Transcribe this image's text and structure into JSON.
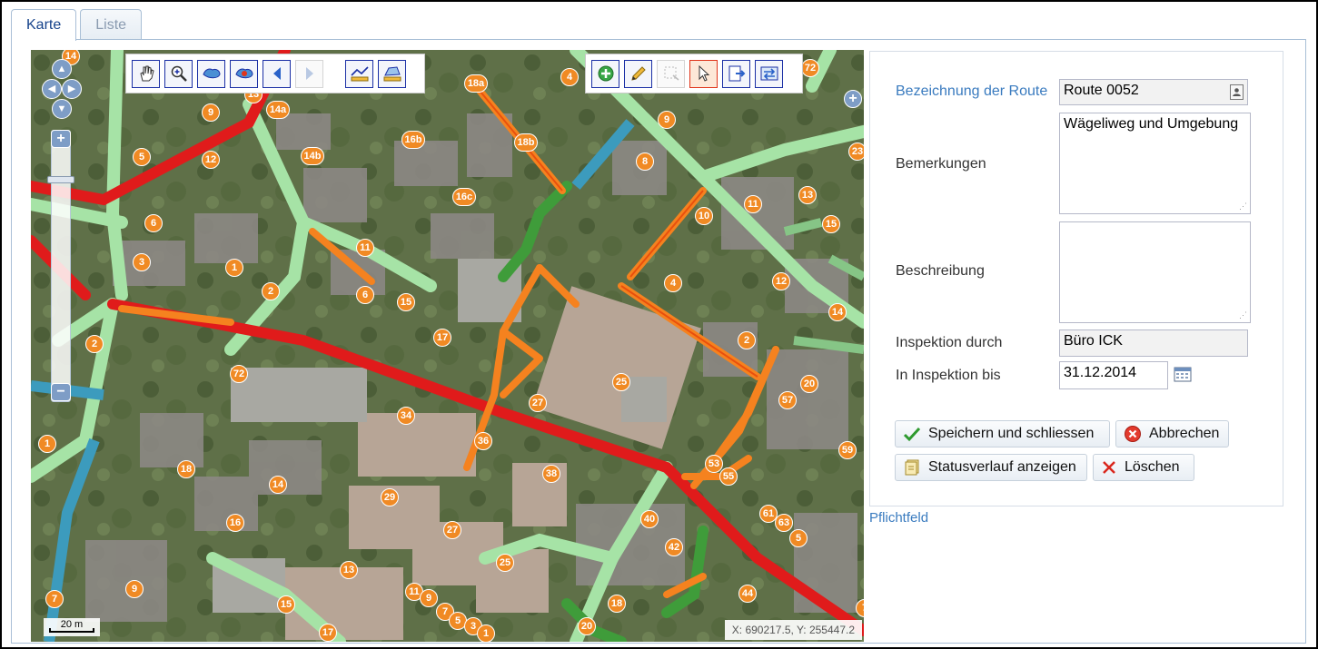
{
  "tabs": [
    {
      "label": "Karte"
    },
    {
      "label": "Liste"
    }
  ],
  "map": {
    "scale_label": "20 m",
    "coordinates": "X: 690217.5, Y: 255447.2",
    "labels": [
      "14",
      "13",
      "14a",
      "9",
      "5",
      "12",
      "6",
      "3",
      "1",
      "2",
      "2",
      "1",
      "18a",
      "18b",
      "4",
      "9",
      "16b",
      "14b",
      "16c",
      "11",
      "6",
      "15",
      "17",
      "8",
      "10",
      "11",
      "13",
      "15",
      "4",
      "12",
      "14",
      "2",
      "20",
      "57",
      "53",
      "55",
      "25",
      "27",
      "36",
      "34",
      "38",
      "29",
      "27",
      "25",
      "40",
      "42",
      "61",
      "63",
      "5",
      "44",
      "18",
      "20",
      "13",
      "15",
      "17",
      "11",
      "9",
      "7",
      "5",
      "3",
      "1",
      "14",
      "16",
      "18",
      "9",
      "7",
      "72",
      "59",
      "7",
      "23",
      "72"
    ]
  },
  "form": {
    "route_label": "Bezeichnung der Route",
    "route_value": "Route 0052",
    "remarks_label": "Bemerkungen",
    "remarks_value": "Wägeliweg und Umgebung",
    "description_label": "Beschreibung",
    "description_value": "",
    "inspection_by_label": "Inspektion durch",
    "inspection_by_value": "Büro ICK",
    "inspection_until_label": "In Inspektion bis",
    "inspection_until_value": "31.12.2014"
  },
  "buttons": {
    "save": "Speichern und schliessen",
    "cancel": "Abbrechen",
    "history": "Statusverlauf anzeigen",
    "delete": "Löschen"
  },
  "required_note": "Pflichtfeld",
  "colors": {
    "accent": "#3a7bbf",
    "route_red": "#e01b1b",
    "route_orange": "#f5821f",
    "path_green": "#a6e3a6",
    "path_blue": "#3c9bbd"
  }
}
